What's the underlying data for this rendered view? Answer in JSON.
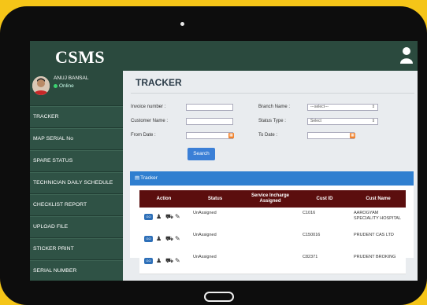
{
  "app": {
    "logo": "CSMS",
    "user_icon": "user-icon"
  },
  "user": {
    "name": "ANUJ BANSAL",
    "status": "Online"
  },
  "sidebar": {
    "items": [
      {
        "label": "TRACKER"
      },
      {
        "label": "MAP SERIAL No"
      },
      {
        "label": "SPARE STATUS"
      },
      {
        "label": "TECHNICIAN DAILY SCHEDULE"
      },
      {
        "label": "CHECKLIST REPORT"
      },
      {
        "label": "UPLOAD FILE"
      },
      {
        "label": "STICKER PRINT"
      },
      {
        "label": "SERIAL NUMBER"
      }
    ]
  },
  "page": {
    "title": "TRACKER"
  },
  "form": {
    "invoice_label": "Invoice number :",
    "invoice_value": "",
    "branch_label": "Branch Name :",
    "branch_value": "---select---",
    "customer_label": "Customer Name :",
    "customer_value": "",
    "status_label": "Status Type :",
    "status_value": "Select",
    "from_label": "From Date :",
    "from_value": "",
    "to_label": "To Date :",
    "to_value": "",
    "search_label": "Search"
  },
  "panel": {
    "title": "Tracker"
  },
  "table": {
    "headers": [
      "Action",
      "Status",
      "Service Incharge Assigned",
      "Cust ID",
      "Cust Name"
    ],
    "rows": [
      {
        "status": "UnAssigned",
        "incharge": "",
        "cust_id": "C1016",
        "cust_name": "AAROGYAM SPECIALITY HOSPITAL"
      },
      {
        "status": "UnAssigned",
        "incharge": "",
        "cust_id": "C150016",
        "cust_name": "PRUDENT CAS LTD"
      },
      {
        "status": "UnAssigned",
        "incharge": "",
        "cust_id": "C82371",
        "cust_name": "PRUDENT BROKING"
      }
    ]
  },
  "colors": {
    "frame": "#f5c518",
    "sidebar": "#2f5245",
    "header_row": "#5b0e0e",
    "accent": "#2f7fd0"
  }
}
